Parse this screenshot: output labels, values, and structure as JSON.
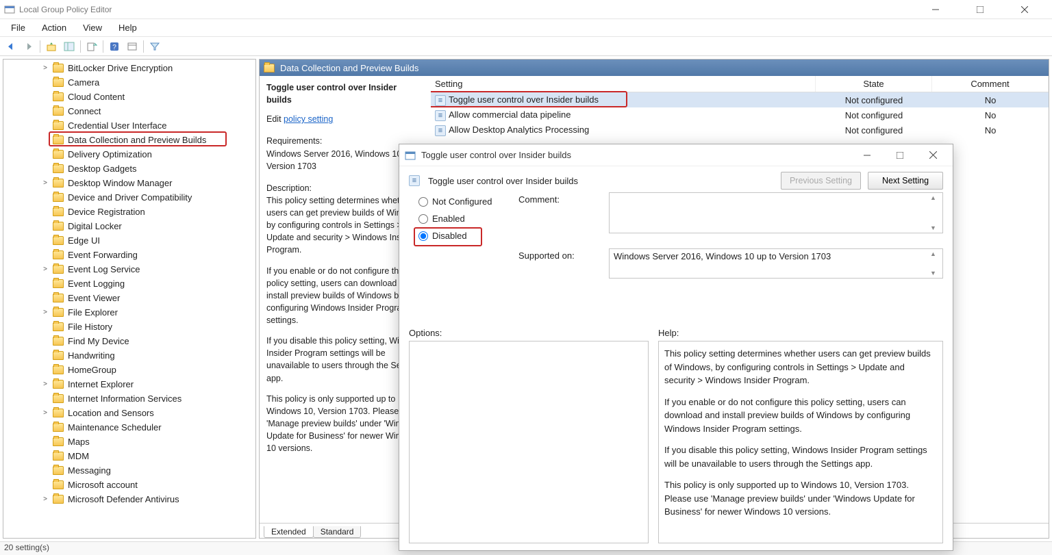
{
  "window": {
    "title": "Local Group Policy Editor"
  },
  "menus": [
    "File",
    "Action",
    "View",
    "Help"
  ],
  "tree": {
    "selected": "Data Collection and Preview Builds",
    "items": [
      {
        "label": "BitLocker Drive Encryption",
        "expandable": true
      },
      {
        "label": "Camera"
      },
      {
        "label": "Cloud Content"
      },
      {
        "label": "Connect"
      },
      {
        "label": "Credential User Interface"
      },
      {
        "label": "Data Collection and Preview Builds",
        "selected": true
      },
      {
        "label": "Delivery Optimization"
      },
      {
        "label": "Desktop Gadgets"
      },
      {
        "label": "Desktop Window Manager",
        "expandable": true
      },
      {
        "label": "Device and Driver Compatibility"
      },
      {
        "label": "Device Registration"
      },
      {
        "label": "Digital Locker"
      },
      {
        "label": "Edge UI"
      },
      {
        "label": "Event Forwarding"
      },
      {
        "label": "Event Log Service",
        "expandable": true
      },
      {
        "label": "Event Logging"
      },
      {
        "label": "Event Viewer"
      },
      {
        "label": "File Explorer",
        "expandable": true
      },
      {
        "label": "File History"
      },
      {
        "label": "Find My Device"
      },
      {
        "label": "Handwriting"
      },
      {
        "label": "HomeGroup"
      },
      {
        "label": "Internet Explorer",
        "expandable": true
      },
      {
        "label": "Internet Information Services"
      },
      {
        "label": "Location and Sensors",
        "expandable": true
      },
      {
        "label": "Maintenance Scheduler"
      },
      {
        "label": "Maps"
      },
      {
        "label": "MDM"
      },
      {
        "label": "Messaging"
      },
      {
        "label": "Microsoft account"
      },
      {
        "label": "Microsoft Defender Antivirus",
        "expandable": true
      }
    ]
  },
  "rightPane": {
    "header": "Data Collection and Preview Builds",
    "detail": {
      "title": "Toggle user control over Insider builds",
      "editLabel": "Edit",
      "editLink": "policy setting",
      "requirementsLabel": "Requirements:",
      "requirements": "Windows Server 2016, Windows 10 up to Version 1703",
      "descriptionLabel": "Description:",
      "descP1": "This policy setting determines whether users can get preview builds of Windows, by configuring controls in Settings > Update and security > Windows Insider Program.",
      "descP2": "If you enable or do not configure this policy setting, users can download and install preview builds of Windows by configuring Windows Insider Program settings.",
      "descP3": "If you disable this policy setting, Windows Insider Program settings will be unavailable to users through the Settings app.",
      "descP4": "This policy is only supported up to Windows 10, Version 1703. Please use 'Manage preview builds' under 'Windows Update for Business' for newer Windows 10 versions."
    },
    "columns": {
      "setting": "Setting",
      "state": "State",
      "comment": "Comment"
    },
    "rows": [
      {
        "setting": "Toggle user control over Insider builds",
        "state": "Not configured",
        "comment": "No",
        "selected": true
      },
      {
        "setting": "Allow commercial data pipeline",
        "state": "Not configured",
        "comment": "No"
      },
      {
        "setting": "Allow Desktop Analytics Processing",
        "state": "Not configured",
        "comment": "No"
      }
    ],
    "tabs": {
      "extended": "Extended",
      "standard": "Standard"
    }
  },
  "dialog": {
    "title": "Toggle user control over Insider builds",
    "heading": "Toggle user control over Insider builds",
    "prevBtn": "Previous Setting",
    "nextBtn": "Next Setting",
    "radios": {
      "notConfigured": "Not Configured",
      "enabled": "Enabled",
      "disabled": "Disabled",
      "selected": "disabled"
    },
    "commentLabel": "Comment:",
    "commentValue": "",
    "supportedLabel": "Supported on:",
    "supportedValue": "Windows Server 2016, Windows 10 up to Version 1703",
    "optionsLabel": "Options:",
    "helpLabel": "Help:",
    "helpP1": "This policy setting determines whether users can get preview builds of Windows, by configuring controls in Settings > Update and security > Windows Insider Program.",
    "helpP2": "If you enable or do not configure this policy setting, users can download and install preview builds of Windows by configuring Windows Insider Program settings.",
    "helpP3": "If you disable this policy setting, Windows Insider Program settings will be unavailable to users through the Settings app.",
    "helpP4": "This policy is only supported up to Windows 10, Version 1703. Please use 'Manage preview builds' under 'Windows Update for Business' for newer Windows 10 versions."
  },
  "status": "20 setting(s)"
}
